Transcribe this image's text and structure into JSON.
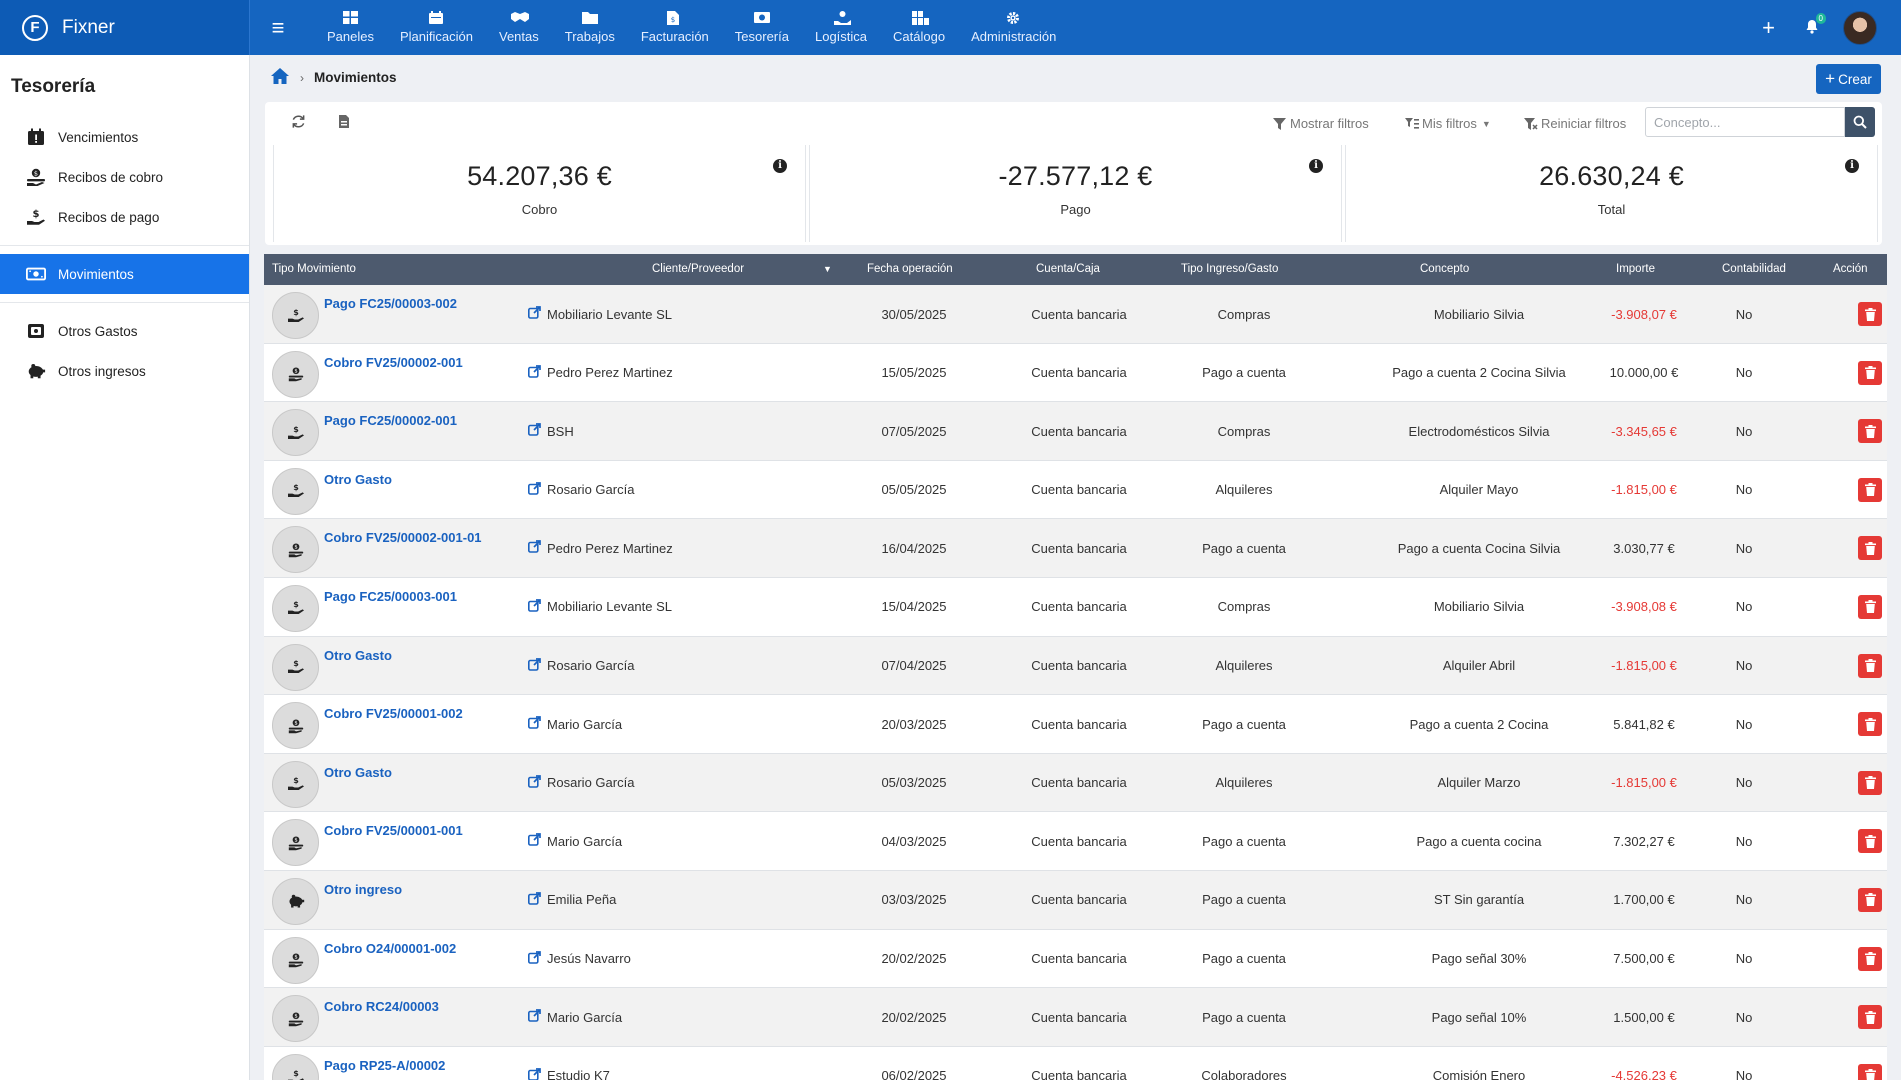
{
  "app": {
    "name": "Fixner",
    "logo_letter": "F"
  },
  "topnav": [
    {
      "label": "Paneles",
      "icon": "dashboard-icon"
    },
    {
      "label": "Planificación",
      "icon": "calendar-icon"
    },
    {
      "label": "Ventas",
      "icon": "handshake-icon"
    },
    {
      "label": "Trabajos",
      "icon": "folder-icon"
    },
    {
      "label": "Facturación",
      "icon": "invoice-icon"
    },
    {
      "label": "Tesorería",
      "icon": "cash-icon"
    },
    {
      "label": "Logística",
      "icon": "logistics-icon"
    },
    {
      "label": "Catálogo",
      "icon": "catalog-icon"
    },
    {
      "label": "Administración",
      "icon": "gear-icon"
    }
  ],
  "topright": {
    "plus": "+",
    "notifications": "0"
  },
  "sidebar": {
    "title": "Tesorería",
    "items": [
      {
        "label": "Vencimientos",
        "icon": "calendar-alert-icon"
      },
      {
        "label": "Recibos de cobro",
        "icon": "receive-money-icon"
      },
      {
        "label": "Recibos de pago",
        "icon": "pay-money-icon"
      },
      {
        "label": "Movimientos",
        "icon": "money-bill-icon",
        "active": true
      },
      {
        "label": "Otros Gastos",
        "icon": "cash-register-icon"
      },
      {
        "label": "Otros ingresos",
        "icon": "piggy-bank-icon"
      }
    ]
  },
  "breadcrumb": {
    "current": "Movimientos"
  },
  "actions": {
    "create_label": "Crear"
  },
  "toolbar": {
    "show_filters": "Mostrar filtros",
    "my_filters": "Mis filtros",
    "reset_filters": "Reiniciar filtros",
    "search_placeholder": "Concepto..."
  },
  "kpis": [
    {
      "value": "54.207,36 €",
      "label": "Cobro"
    },
    {
      "value": "-27.577,12 €",
      "label": "Pago"
    },
    {
      "value": "26.630,24 €",
      "label": "Total"
    }
  ],
  "table": {
    "columns": [
      "Tipo Movimiento",
      "Cliente/Proveedor",
      "Fecha operación",
      "Cuenta/Caja",
      "Tipo Ingreso/Gasto",
      "Concepto",
      "Importe",
      "Contabilidad",
      "Acción"
    ],
    "rows": [
      {
        "kind": "pago",
        "type": "Pago FC25/00003-002",
        "client": "Mobiliario Levante SL",
        "date": "30/05/2025",
        "account": "Cuenta bancaria",
        "category": "Compras",
        "concept": "Mobiliario Silvia",
        "amount": "-3.908,07 €",
        "neg": true,
        "accounting": "No"
      },
      {
        "kind": "cobro",
        "type": "Cobro FV25/00002-001",
        "client": "Pedro Perez Martinez",
        "date": "15/05/2025",
        "account": "Cuenta bancaria",
        "category": "Pago a cuenta",
        "concept": "Pago a cuenta 2 Cocina Silvia",
        "amount": "10.000,00 €",
        "neg": false,
        "accounting": "No"
      },
      {
        "kind": "pago",
        "type": "Pago FC25/00002-001",
        "client": "BSH",
        "date": "07/05/2025",
        "account": "Cuenta bancaria",
        "category": "Compras",
        "concept": "Electrodomésticos Silvia",
        "amount": "-3.345,65 €",
        "neg": true,
        "accounting": "No"
      },
      {
        "kind": "pago",
        "type": "Otro Gasto",
        "client": "Rosario García",
        "date": "05/05/2025",
        "account": "Cuenta bancaria",
        "category": "Alquileres",
        "concept": "Alquiler Mayo",
        "amount": "-1.815,00 €",
        "neg": true,
        "accounting": "No"
      },
      {
        "kind": "cobro",
        "type": "Cobro FV25/00002-001-01",
        "client": "Pedro Perez Martinez",
        "date": "16/04/2025",
        "account": "Cuenta bancaria",
        "category": "Pago a cuenta",
        "concept": "Pago a cuenta Cocina Silvia",
        "amount": "3.030,77 €",
        "neg": false,
        "accounting": "No"
      },
      {
        "kind": "pago",
        "type": "Pago FC25/00003-001",
        "client": "Mobiliario Levante SL",
        "date": "15/04/2025",
        "account": "Cuenta bancaria",
        "category": "Compras",
        "concept": "Mobiliario Silvia",
        "amount": "-3.908,08 €",
        "neg": true,
        "accounting": "No"
      },
      {
        "kind": "pago",
        "type": "Otro Gasto",
        "client": "Rosario García",
        "date": "07/04/2025",
        "account": "Cuenta bancaria",
        "category": "Alquileres",
        "concept": "Alquiler Abril",
        "amount": "-1.815,00 €",
        "neg": true,
        "accounting": "No"
      },
      {
        "kind": "cobro",
        "type": "Cobro FV25/00001-002",
        "client": "Mario García",
        "date": "20/03/2025",
        "account": "Cuenta bancaria",
        "category": "Pago a cuenta",
        "concept": "Pago a cuenta 2 Cocina",
        "amount": "5.841,82 €",
        "neg": false,
        "accounting": "No"
      },
      {
        "kind": "pago",
        "type": "Otro Gasto",
        "client": "Rosario García",
        "date": "05/03/2025",
        "account": "Cuenta bancaria",
        "category": "Alquileres",
        "concept": "Alquiler Marzo",
        "amount": "-1.815,00 €",
        "neg": true,
        "accounting": "No"
      },
      {
        "kind": "cobro",
        "type": "Cobro FV25/00001-001",
        "client": "Mario García",
        "date": "04/03/2025",
        "account": "Cuenta bancaria",
        "category": "Pago a cuenta",
        "concept": "Pago a cuenta cocina",
        "amount": "7.302,27 €",
        "neg": false,
        "accounting": "No"
      },
      {
        "kind": "ingreso",
        "type": "Otro ingreso",
        "client": "Emilia Peña",
        "date": "03/03/2025",
        "account": "Cuenta bancaria",
        "category": "Pago a cuenta",
        "concept": "ST Sin garantía",
        "amount": "1.700,00 €",
        "neg": false,
        "accounting": "No"
      },
      {
        "kind": "cobro",
        "type": "Cobro O24/00001-002",
        "client": "Jesús Navarro",
        "date": "20/02/2025",
        "account": "Cuenta bancaria",
        "category": "Pago a cuenta",
        "concept": "Pago señal 30%",
        "amount": "7.500,00 €",
        "neg": false,
        "accounting": "No"
      },
      {
        "kind": "cobro",
        "type": "Cobro RC24/00003",
        "client": "Mario García",
        "date": "20/02/2025",
        "account": "Cuenta bancaria",
        "category": "Pago a cuenta",
        "concept": "Pago señal 10%",
        "amount": "1.500,00 €",
        "neg": false,
        "accounting": "No"
      },
      {
        "kind": "pago",
        "type": "Pago RP25-A/00002",
        "client": "Estudio K7",
        "date": "06/02/2025",
        "account": "Cuenta bancaria",
        "category": "Colaboradores",
        "concept": "Comisión Enero",
        "amount": "-4.526,23 €",
        "neg": true,
        "accounting": "No"
      }
    ]
  },
  "colors": {
    "primary": "#1565c0",
    "active": "#1773e8",
    "header": "#4d5a6e",
    "danger": "#e53935",
    "link": "#1a62c0"
  }
}
